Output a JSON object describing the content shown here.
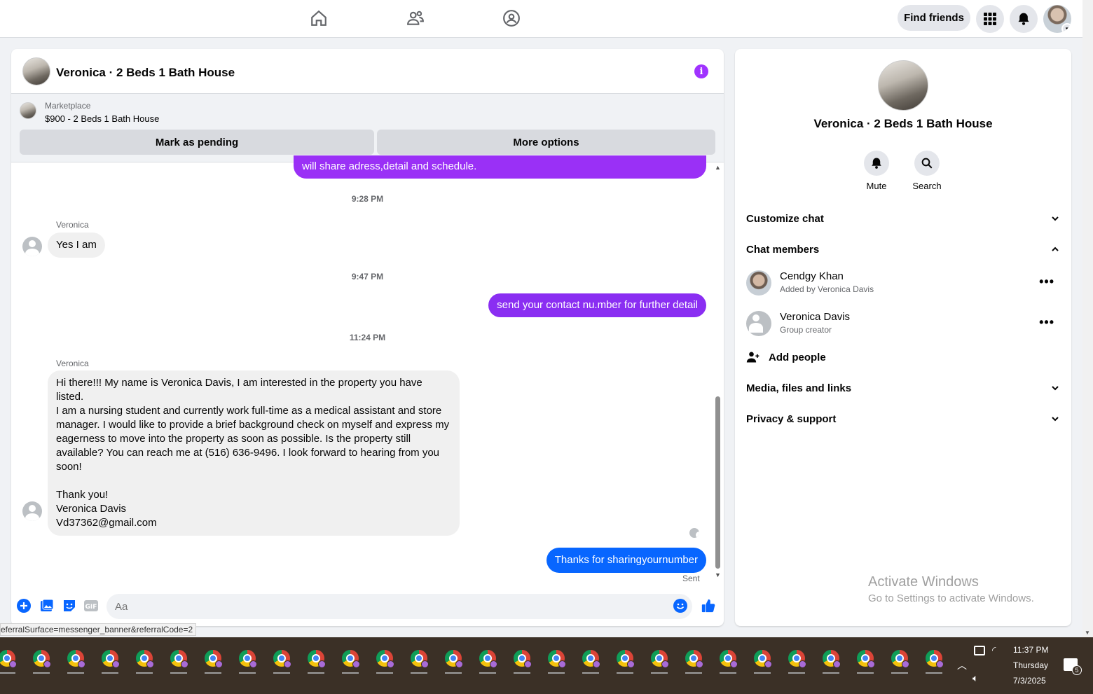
{
  "topnav": {
    "find_friends": "Find friends"
  },
  "chat": {
    "title": "Veronica · 2 Beds 1 Bath House",
    "marketplace_label": "Marketplace",
    "listing": "$900 - 2 Beds 1 Bath House",
    "mark_pending": "Mark as pending",
    "more_options": "More options",
    "messages": {
      "partial_out": "will share adress,detail and schedule.",
      "ts1": "9:28 PM",
      "sender1": "Veronica",
      "in1": "Yes I am",
      "ts2": "9:47 PM",
      "out1": "send your contact nu.mber for further detail",
      "ts3": "11:24 PM",
      "sender2": "Veronica",
      "in2": "Hi there!!! My name is Veronica Davis, I am interested in the property you have listed.\nI am a nursing student and currently work full-time as a medical assistant and store\nmanager. I would like to provide a brief background check on myself and express my\neagerness to move into the property as soon as possible. Is the property still\navailable? You can reach me at (516) 636-9496. I look forward to hearing from you\nsoon!\n\nThank you!\nVeronica Davis\nVd37362@gmail.com",
      "out2": "Thanks for sharingyournumber",
      "sent_status": "Sent"
    },
    "composer_placeholder": "Aa",
    "status_url": "eferralSurface=messenger_banner&referralCode=2"
  },
  "details": {
    "title": "Veronica · 2 Beds 1 Bath House",
    "mute": "Mute",
    "search": "Search",
    "customize": "Customize chat",
    "members_header": "Chat members",
    "members": [
      {
        "name": "Cendgy Khan",
        "sub": "Added by Veronica Davis"
      },
      {
        "name": "Veronica Davis",
        "sub": "Group creator"
      }
    ],
    "add_people": "Add people",
    "media": "Media, files and links",
    "privacy": "Privacy & support",
    "watermark_title": "Activate Windows",
    "watermark_sub": "Go to Settings to activate Windows."
  },
  "taskbar": {
    "time": "11:37 PM",
    "day": "Thursday",
    "date": "7/3/2025",
    "notif_count": "5"
  },
  "colors": {
    "purple": "#a033ff",
    "out_purple": "#8b2ff0",
    "blue": "#0866ff",
    "taskbar": "#3b3026"
  }
}
